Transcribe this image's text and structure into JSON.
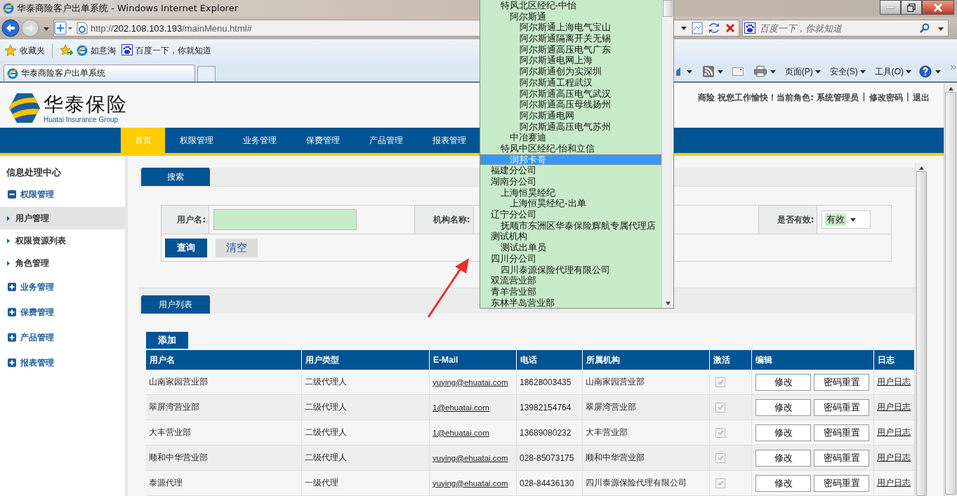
{
  "window": {
    "title": "华泰商险客户出单系统 - Windows Internet Explorer"
  },
  "address_bar": {
    "url": "http://202.108.103.193/mainMenu.html#"
  },
  "search_box": {
    "placeholder": "百度一下，你就知道"
  },
  "favorites_bar": {
    "label": "收藏夹",
    "links": [
      "如意淘",
      "百度一下，你就知道"
    ]
  },
  "tabs": [
    {
      "label": "华泰商险客户出单系统",
      "selected": true
    }
  ],
  "command_bar": {
    "menus": [
      "页面(P)",
      "安全(S)",
      "工具(O)"
    ]
  },
  "header": {
    "logo_text": "华泰保险",
    "logo_subtitle": "Huatai Insurance Group",
    "greeting": "商险 祝您工作愉快！当前角色: 系统管理员",
    "links": [
      {
        "separator": "|",
        "label": "修改密码"
      },
      {
        "separator": "|",
        "label": "退出"
      }
    ]
  },
  "nav": [
    {
      "label": "首页",
      "selected": true
    },
    {
      "label": "权限管理",
      "selected": false
    },
    {
      "label": "业务管理",
      "selected": false
    },
    {
      "label": "保费管理",
      "selected": false
    },
    {
      "label": "产品管理",
      "selected": false
    },
    {
      "label": "报表管理",
      "selected": false
    }
  ],
  "sidebar": {
    "title": "信息处理中心",
    "groups": [
      {
        "label": "权限管理",
        "expanded": true,
        "items": [
          {
            "label": "用户管理",
            "selected": true
          },
          {
            "label": "权限资源列表",
            "selected": false
          },
          {
            "label": "角色管理",
            "selected": false
          }
        ]
      },
      {
        "label": "业务管理",
        "expanded": false
      },
      {
        "label": "保费管理",
        "expanded": false
      },
      {
        "label": "产品管理",
        "expanded": false
      },
      {
        "label": "报表管理",
        "expanded": false
      }
    ]
  },
  "search_panel": {
    "tab": "搜索",
    "fields": [
      {
        "label": "用户名:",
        "kind": "text"
      },
      {
        "label": "机构名称:",
        "kind": "covered"
      },
      {
        "label": "是否有效:",
        "kind": "select",
        "value": "有效"
      }
    ],
    "buttons": [
      "查询",
      "清空"
    ]
  },
  "user_list": {
    "tab": "用户列表",
    "add_button": "添加",
    "columns": [
      "用户名",
      "用户类型",
      "E-Mail",
      "电话",
      "所属机构",
      "激活",
      "编辑",
      "日志"
    ],
    "rows": [
      {
        "cells": [
          "山南家园营业部",
          "二级代理人",
          "yuying@ehuatai.com",
          "18628003435",
          "山南家园营业部"
        ],
        "active": true,
        "actions": [
          "修改",
          "密码重置"
        ],
        "log": "用户日志"
      },
      {
        "cells": [
          "翠屏湾营业部",
          "二级代理人",
          "1@ehuatai.com",
          "13982154764",
          "翠屏湾营业部"
        ],
        "active": true,
        "actions": [
          "修改",
          "密码重置"
        ],
        "log": "用户日志"
      },
      {
        "cells": [
          "大丰营业部",
          "二级代理人",
          "1@ehuatai.com",
          "13689080232",
          "大丰营业部"
        ],
        "active": true,
        "actions": [
          "修改",
          "密码重置"
        ],
        "log": "用户日志"
      },
      {
        "cells": [
          "顺和中华营业部",
          "二级代理人",
          "yuying@ehuatai.com",
          "028-85073175",
          "顺和中华营业部"
        ],
        "active": true,
        "actions": [
          "修改",
          "密码重置"
        ],
        "log": "用户日志"
      },
      {
        "cells": [
          "泰源代理",
          "一级代理",
          "yuying@ehuatai.com",
          "028-84436130",
          "四川泰源保险代理有限公司"
        ],
        "active": true,
        "actions": [
          "修改",
          "密码重置"
        ],
        "log": "用户日志"
      }
    ]
  },
  "dropdown": {
    "cut_parent_children": [
      {
        "label": "特风北区经纪-中怡",
        "selected": false,
        "children": [
          {
            "label": "阿尔斯通",
            "selected": false,
            "children": [
              {
                "label": "阿尔斯通上海电气宝山",
                "selected": false
              },
              {
                "label": "阿尔斯通隔离开关无锡",
                "selected": false
              },
              {
                "label": "阿尔斯通高压电气广东",
                "selected": false
              },
              {
                "label": "阿尔斯通电网上海",
                "selected": false
              },
              {
                "label": "阿尔斯通创为实深圳",
                "selected": false
              },
              {
                "label": "阿尔斯通工程武汉",
                "selected": false
              },
              {
                "label": "阿尔斯通高压电气武汉",
                "selected": false
              },
              {
                "label": "阿尔斯通高压母线扬州",
                "selected": false
              },
              {
                "label": "阿尔斯通电网",
                "selected": false
              },
              {
                "label": "阿尔斯通高压电气苏州",
                "selected": false
              }
            ]
          },
          {
            "label": "中冶赛迪",
            "selected": false
          }
        ]
      },
      {
        "label": "特风中区经纪-怡和立信",
        "selected": false,
        "children": [
          {
            "label": "润邦卡哥",
            "selected": true
          }
        ]
      }
    ],
    "options": [
      {
        "label": "福建分公司",
        "selected": false
      },
      {
        "label": "湖南分公司",
        "selected": false,
        "children": [
          {
            "label": "上海恒昊经纪",
            "selected": false,
            "children": [
              {
                "label": "上海恒昊经纪-出单",
                "selected": false
              }
            ]
          }
        ]
      },
      {
        "label": "辽宁分公司",
        "selected": false,
        "children": [
          {
            "label": "抚顺市东洲区华泰保险辉航专属代理店",
            "selected": false
          }
        ]
      },
      {
        "label": "测试机构",
        "selected": false,
        "children": [
          {
            "label": "测试出单员",
            "selected": false
          }
        ]
      },
      {
        "label": "四川分公司",
        "selected": false,
        "children": [
          {
            "label": "四川泰源保险代理有限公司",
            "selected": false
          }
        ]
      },
      {
        "label": "双流营业部",
        "selected": false
      },
      {
        "label": "青羊营业部",
        "selected": false
      },
      {
        "label": "东林半岛营业部",
        "selected": false
      }
    ]
  }
}
